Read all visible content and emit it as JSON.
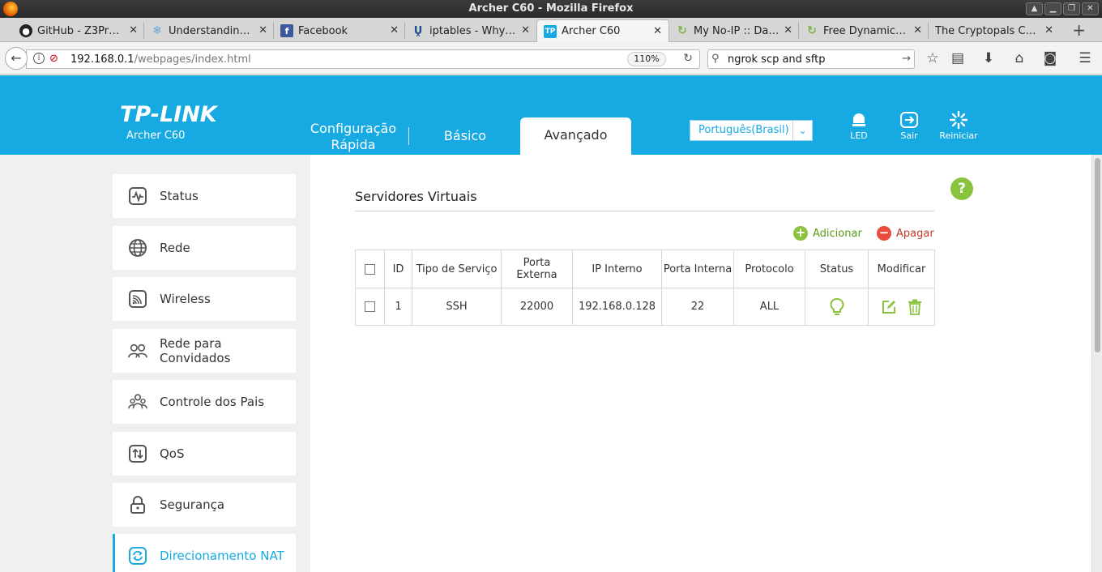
{
  "window": {
    "title": "Archer C60 - Mozilla Firefox"
  },
  "tabs": [
    {
      "label": "GitHub - Z3Pr…",
      "icon": "github-icon"
    },
    {
      "label": "Understandin…",
      "icon": "snowflake-icon"
    },
    {
      "label": "Facebook",
      "icon": "facebook-icon"
    },
    {
      "label": "iptables - Why…",
      "icon": "ul-icon"
    },
    {
      "label": "Archer C60",
      "icon": "tplink-icon",
      "active": true
    },
    {
      "label": "My No-IP :: Da…",
      "icon": "noip-icon"
    },
    {
      "label": "Free Dynamic…",
      "icon": "noip-icon"
    },
    {
      "label": "The Cryptopals C…",
      "icon": ""
    }
  ],
  "nav": {
    "url_host": "192.168.0.1",
    "url_path": "/webpages/index.html",
    "zoom": "110%",
    "search": "ngrok scp and sftp"
  },
  "router": {
    "logo": "TP-LINK",
    "model": "Archer C60",
    "nav_quick_1": "Configuração",
    "nav_quick_2": "Rápida",
    "nav_basic": "Básico",
    "nav_advanced": "Avançado",
    "language": "Português(Brasil)",
    "led": "LED",
    "logout": "Sair",
    "reboot": "Reiniciar",
    "accent": "#16a9e2"
  },
  "sidebar": {
    "items": [
      {
        "label": "Status",
        "icon": "status-icon"
      },
      {
        "label": "Rede",
        "icon": "globe-icon"
      },
      {
        "label": "Wireless",
        "icon": "wireless-icon"
      },
      {
        "label": "Rede para Convidados",
        "icon": "guest-icon"
      },
      {
        "label": "Controle dos Pais",
        "icon": "parental-icon"
      },
      {
        "label": "QoS",
        "icon": "qos-icon"
      },
      {
        "label": "Segurança",
        "icon": "lock-icon"
      },
      {
        "label": "Direcionamento NAT",
        "icon": "nat-icon",
        "active": true
      }
    ]
  },
  "main": {
    "title": "Servidores Virtuais",
    "add": "Adicionar",
    "delete": "Apagar",
    "help": "?",
    "columns": [
      "ID",
      "Tipo de Serviço",
      "Porta Externa",
      "IP Interno",
      "Porta Interna",
      "Protocolo",
      "Status",
      "Modificar"
    ],
    "rows": [
      {
        "id": "1",
        "service": "SSH",
        "ext_port": "22000",
        "ip": "192.168.0.128",
        "int_port": "22",
        "protocol": "ALL"
      }
    ]
  }
}
